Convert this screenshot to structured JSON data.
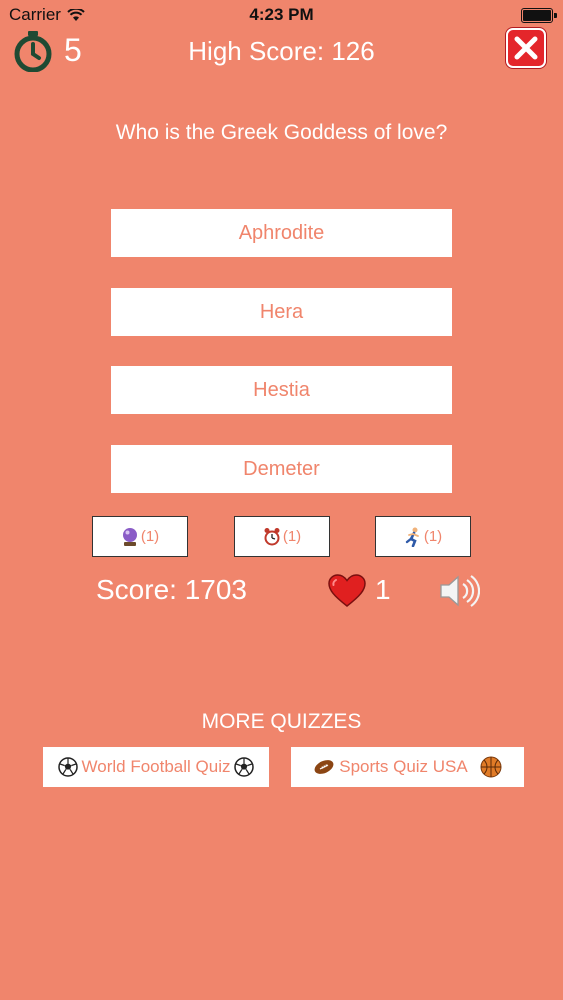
{
  "status_bar": {
    "carrier": "Carrier",
    "time": "4:23 PM"
  },
  "header": {
    "timer_value": "5",
    "high_score": "High Score: 126"
  },
  "question": "Who is the Greek Goddess of love?",
  "answers": [
    "Aphrodite",
    "Hera",
    "Hestia",
    "Demeter"
  ],
  "powerups": [
    {
      "icon": "crystal-ball-icon",
      "count": "(1)"
    },
    {
      "icon": "alarm-clock-icon",
      "count": "(1)"
    },
    {
      "icon": "runner-icon",
      "count": "(1)"
    }
  ],
  "footer_stats": {
    "score": "Score: 1703",
    "lives": "1"
  },
  "more_quizzes": {
    "title": "MORE QUIZZES",
    "items": [
      {
        "label": "World Football Quiz",
        "icon": "soccer-ball-icon"
      },
      {
        "label": "Sports Quiz USA",
        "icon": "football-icon"
      }
    ]
  },
  "colors": {
    "background": "#f0856c",
    "close": "#e4262b",
    "timer": "#1f4a33",
    "heart": "#e02020"
  }
}
